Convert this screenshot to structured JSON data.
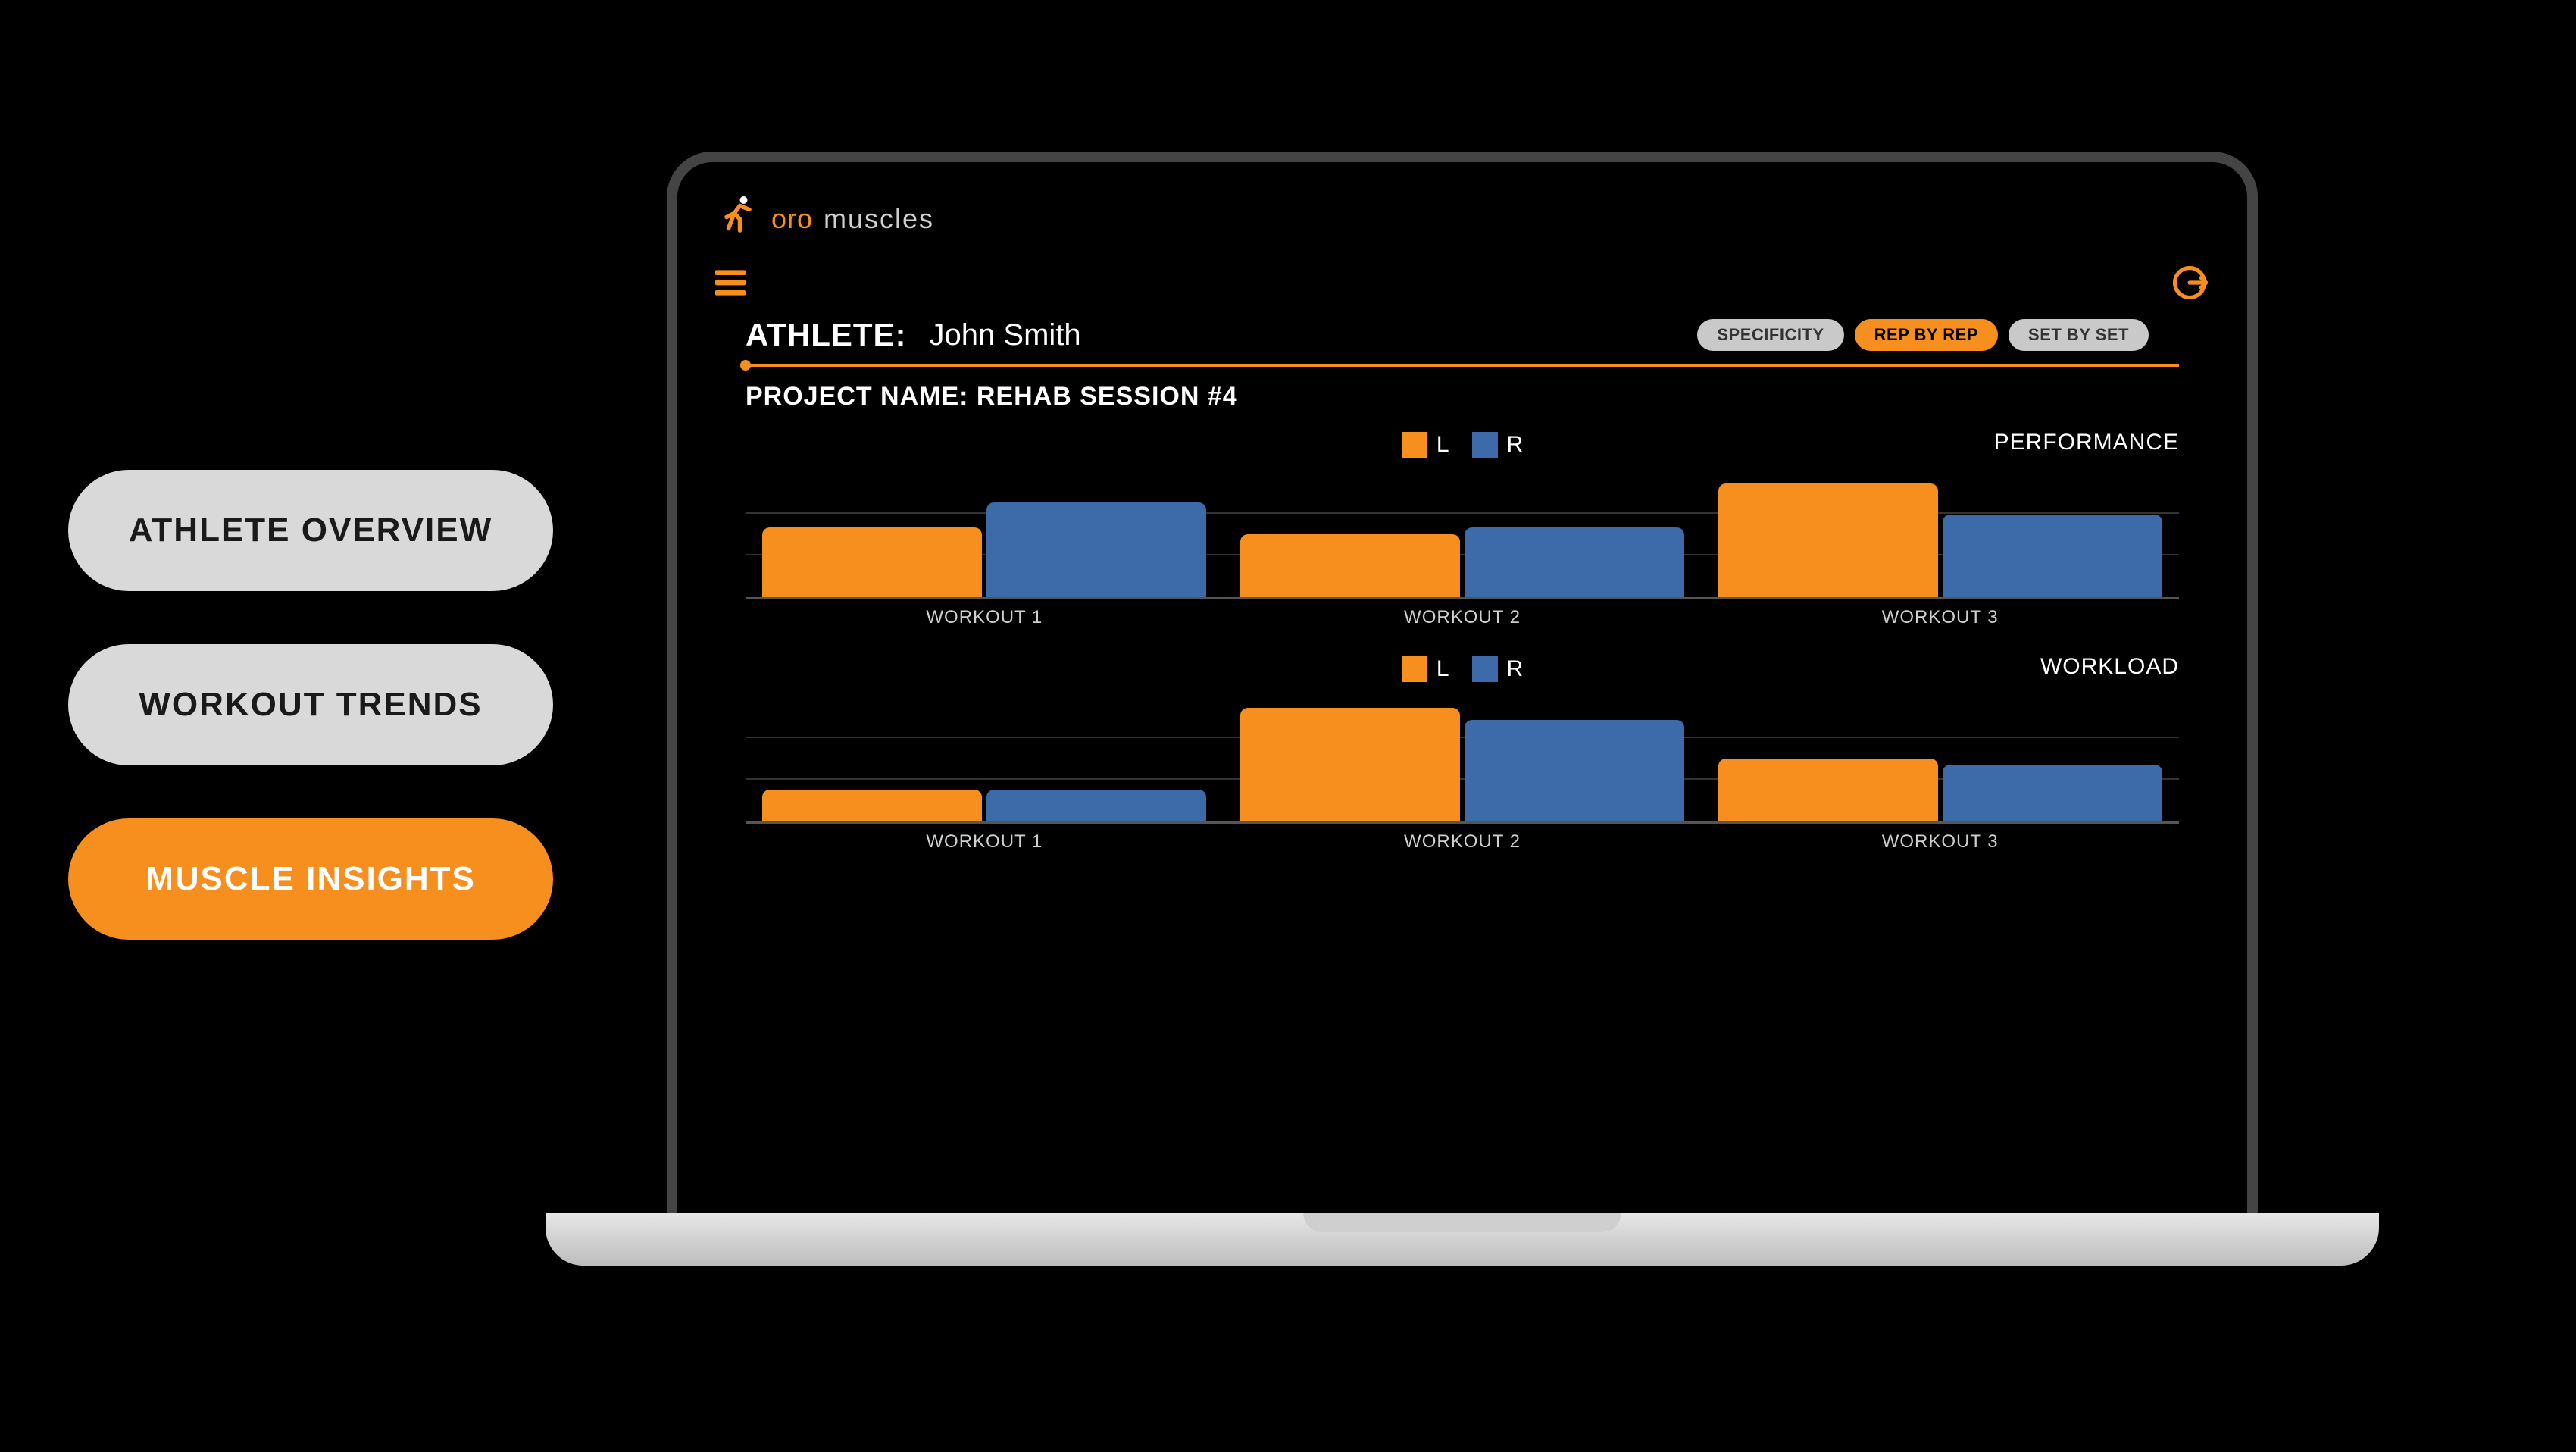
{
  "brand": {
    "oro": "oro",
    "muscles": "muscles"
  },
  "nav": {
    "overview": "ATHLETE OVERVIEW",
    "trends": "WORKOUT TRENDS",
    "insights": "MUSCLE INSIGHTS"
  },
  "header": {
    "athlete_label": "ATHLETE:",
    "athlete_name": "John Smith",
    "tab_specificity": "SPECIFICITY",
    "tab_repbyrep": "REP BY REP",
    "tab_setbyset": "SET BY SET"
  },
  "project_name": "PROJECT NAME: REHAB SESSION #4",
  "legend": {
    "L": "L",
    "R": "R"
  },
  "colors": {
    "accent": "#f78f1e",
    "blue": "#3d6aa8"
  },
  "chart_data": [
    {
      "type": "bar",
      "title": "PERFORMANCE",
      "categories": [
        "WORKOUT 1",
        "WORKOUT 2",
        "WORKOUT 3"
      ],
      "series": [
        {
          "name": "L",
          "values": [
            55,
            50,
            90
          ]
        },
        {
          "name": "R",
          "values": [
            75,
            55,
            65
          ]
        }
      ],
      "ylim": [
        0,
        100
      ]
    },
    {
      "type": "bar",
      "title": "WORKLOAD",
      "categories": [
        "WORKOUT 1",
        "WORKOUT 2",
        "WORKOUT 3"
      ],
      "series": [
        {
          "name": "L",
          "values": [
            25,
            90,
            50
          ]
        },
        {
          "name": "R",
          "values": [
            25,
            80,
            45
          ]
        }
      ],
      "ylim": [
        0,
        100
      ]
    }
  ]
}
